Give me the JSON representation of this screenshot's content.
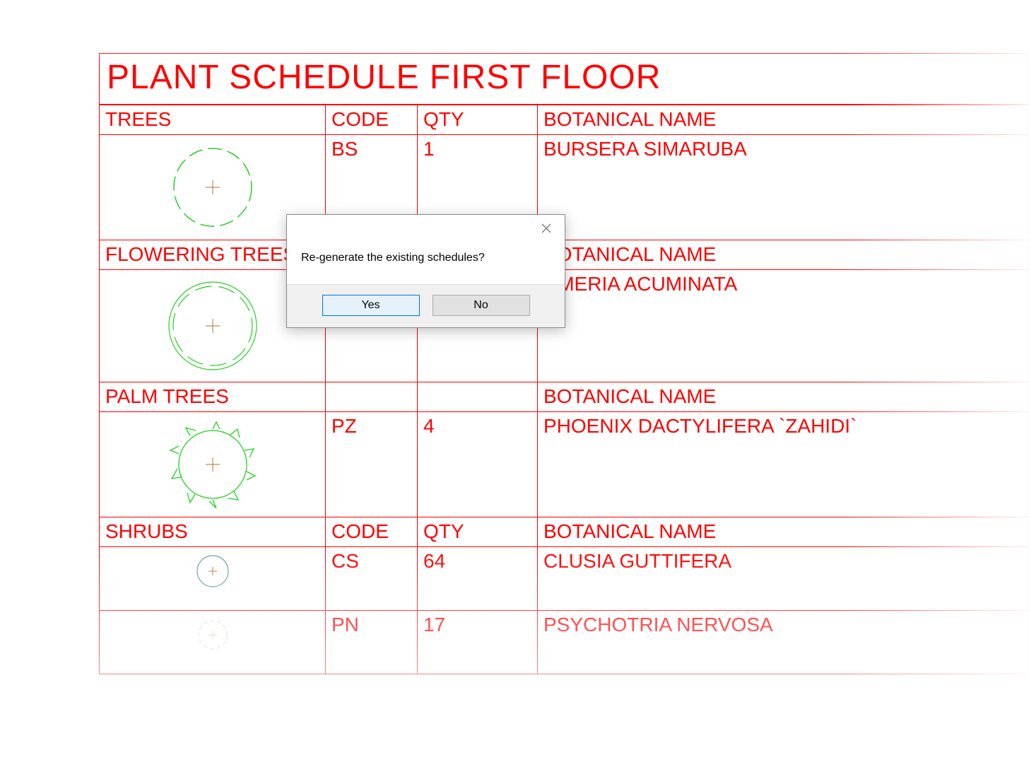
{
  "schedule": {
    "title": "PLANT SCHEDULE FIRST FLOOR",
    "columns": {
      "code": "CODE",
      "qty": "QTY",
      "botanical": "BOTANICAL NAME"
    },
    "sections": [
      {
        "category": "TREES",
        "rows": [
          {
            "code": "BS",
            "qty": "1",
            "botanical": "BURSERA SIMARUBA",
            "symbol": "tree-gear"
          }
        ]
      },
      {
        "category": "FLOWERING TREES",
        "rows": [
          {
            "code": "",
            "qty": "",
            "botanical": "UMERIA ACUMINATA",
            "symbol": "flowering-tree-disc"
          }
        ]
      },
      {
        "category": "PALM TREES",
        "rows": [
          {
            "code": "PZ",
            "qty": "4",
            "botanical": "PHOENIX DACTYLIFERA `ZAHIDI`",
            "symbol": "palm-cog"
          }
        ]
      },
      {
        "category": "SHRUBS",
        "rows": [
          {
            "code": "CS",
            "qty": "64",
            "botanical": "CLUSIA GUTTIFERA",
            "symbol": "shrub-circle"
          },
          {
            "code": "PN",
            "qty": "17",
            "botanical": "PSYCHOTRIA NERVOSA",
            "symbol": "shrub-small-gear"
          }
        ]
      }
    ]
  },
  "dialog": {
    "message": "Re-generate the existing schedules?",
    "yes": "Yes",
    "no": "No"
  }
}
